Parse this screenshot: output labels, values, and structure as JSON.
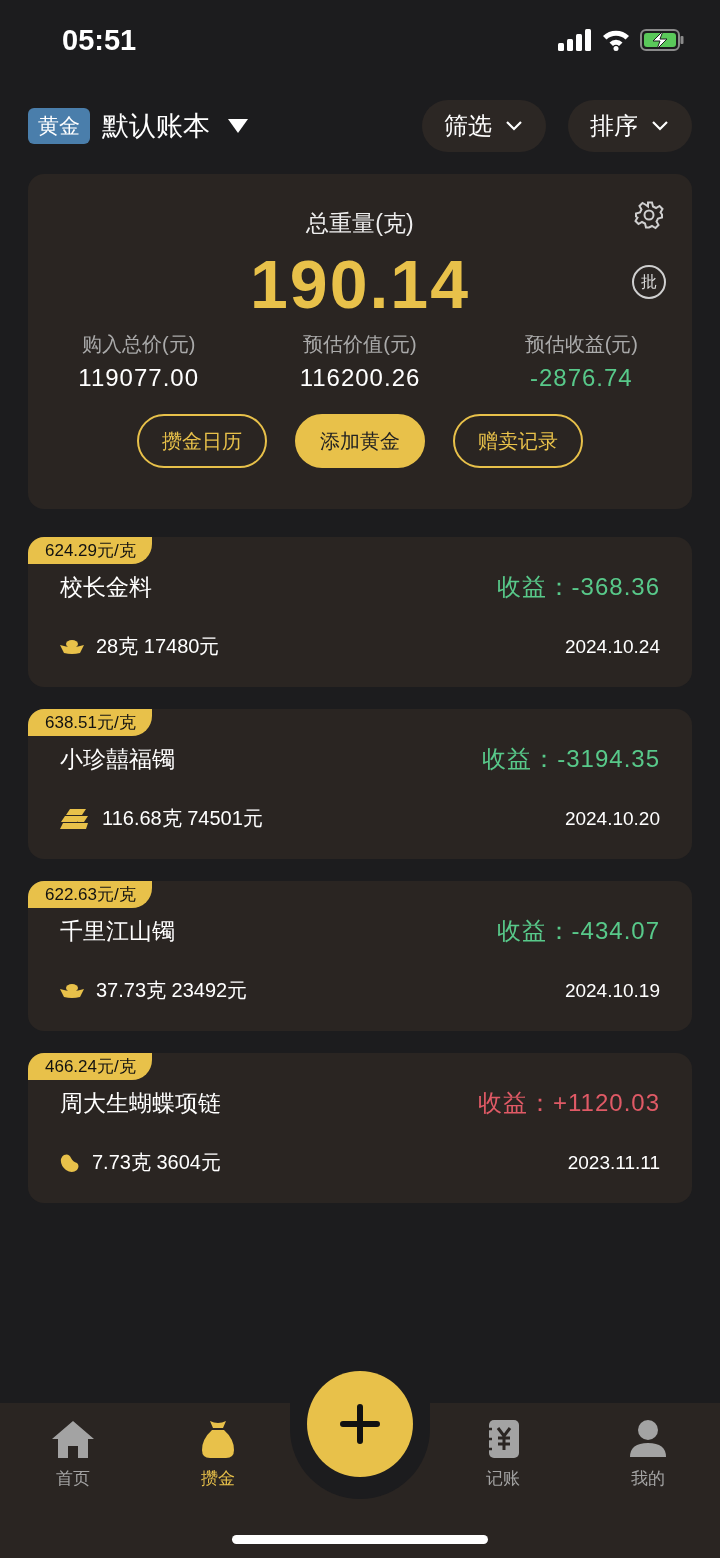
{
  "status_bar": {
    "time": "05:51"
  },
  "header": {
    "badge": "黄金",
    "book": "默认账本",
    "filter": "筛选",
    "sort": "排序"
  },
  "summary": {
    "label": "总重量(克)",
    "total": "190.14",
    "batch": "批",
    "stats": [
      {
        "label": "购入总价(元)",
        "value": "119077.00"
      },
      {
        "label": "预估价值(元)",
        "value": "116200.26"
      },
      {
        "label": "预估收益(元)",
        "value": "-2876.74",
        "gain": false
      }
    ],
    "buttons": [
      {
        "label": "攒金日历",
        "primary": false
      },
      {
        "label": "添加黄金",
        "primary": true
      },
      {
        "label": "赠卖记录",
        "primary": false
      }
    ]
  },
  "items": [
    {
      "price": "624.29元/克",
      "name": "校长金料",
      "profit_label": "收益：",
      "profit": "-368.36",
      "gain": false,
      "kind": "ingot",
      "detail": "28克 17480元",
      "date": "2024.10.24"
    },
    {
      "price": "638.51元/克",
      "name": "小珍囍福镯",
      "profit_label": "收益：",
      "profit": "-3194.35",
      "gain": false,
      "kind": "bars",
      "detail": "116.68克 74501元",
      "date": "2024.10.20"
    },
    {
      "price": "622.63元/克",
      "name": "千里江山镯",
      "profit_label": "收益：",
      "profit": "-434.07",
      "gain": false,
      "kind": "ingot",
      "detail": "37.73克 23492元",
      "date": "2024.10.19"
    },
    {
      "price": "466.24元/克",
      "name": "周大生蝴蝶项链",
      "profit_label": "收益：",
      "profit": "+1120.03",
      "gain": true,
      "kind": "bean",
      "detail": "7.73克 3604元",
      "date": "2023.11.11"
    }
  ],
  "tabs": [
    {
      "label": "首页",
      "selected": false
    },
    {
      "label": "攒金",
      "selected": true
    },
    {
      "label": "记账",
      "selected": false
    },
    {
      "label": "我的",
      "selected": false
    }
  ]
}
